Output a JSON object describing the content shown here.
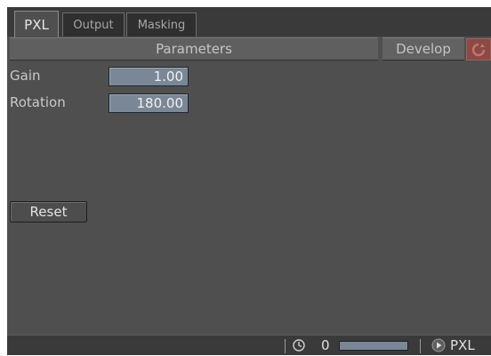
{
  "tabs": [
    {
      "label": "PXL",
      "active": true
    },
    {
      "label": "Output",
      "active": false
    },
    {
      "label": "Masking",
      "active": false
    }
  ],
  "header": {
    "title": "Parameters",
    "develop_label": "Develop",
    "develop_icon": "develop-refresh-icon"
  },
  "params": [
    {
      "label": "Gain",
      "value": "1.00"
    },
    {
      "label": "Rotation",
      "value": "180.00"
    }
  ],
  "reset_label": "Reset",
  "status": {
    "clock_icon": "clock-icon",
    "counter": "0",
    "progress": 0,
    "play_icon": "play-icon",
    "mode": "PXL"
  },
  "colors": {
    "panel": "#4f4f4f",
    "field": "#7a8796",
    "develop_icon": "#8b4a46"
  }
}
